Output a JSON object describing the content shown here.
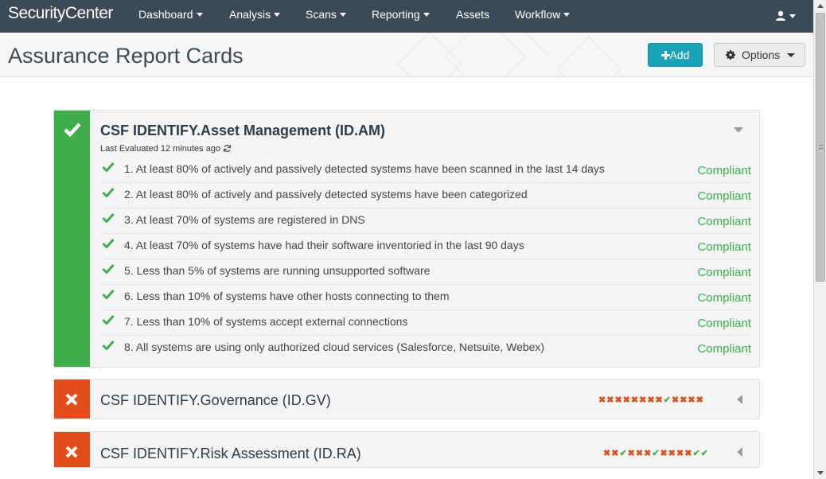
{
  "app": {
    "brand": "SecurityCenter"
  },
  "nav": {
    "items": [
      {
        "label": "Dashboard",
        "dropdown": true
      },
      {
        "label": "Analysis",
        "dropdown": true
      },
      {
        "label": "Scans",
        "dropdown": true
      },
      {
        "label": "Reporting",
        "dropdown": true
      },
      {
        "label": "Assets",
        "dropdown": false
      },
      {
        "label": "Workflow",
        "dropdown": true
      }
    ],
    "user_icon": "user-icon"
  },
  "header": {
    "title": "Assurance Report Cards",
    "add_label": "Add",
    "add_icon": "plus-icon",
    "options_label": "Options",
    "options_icon": "gear-icon"
  },
  "colors": {
    "nav_bg": "#3c4a57",
    "pass": "#3dae49",
    "fail": "#e24d1b",
    "accent": "#1aa3b8"
  },
  "cards": [
    {
      "title": "CSF IDENTIFY.Asset Management (ID.AM)",
      "status": "pass",
      "expanded": true,
      "last_evaluated": "Last Evaluated 12 minutes ago",
      "items": [
        {
          "text": "1. At least 80% of actively and passively detected systems have been scanned in the last 14 days",
          "status": "Compliant"
        },
        {
          "text": "2. At least 80% of actively and passively detected systems have been categorized",
          "status": "Compliant"
        },
        {
          "text": "3. At least 70% of systems are registered in DNS",
          "status": "Compliant"
        },
        {
          "text": "4. At least 70% of systems have had their software inventoried in the last 90 days",
          "status": "Compliant"
        },
        {
          "text": "5. Less than 5% of systems are running unsupported software",
          "status": "Compliant"
        },
        {
          "text": "6. Less than 10% of systems have other hosts connecting to them",
          "status": "Compliant"
        },
        {
          "text": "7. Less than 10% of systems accept external connections",
          "status": "Compliant"
        },
        {
          "text": "8. All systems are using only authorized cloud services (Salesforce, Netsuite, Webex)",
          "status": "Compliant"
        }
      ]
    },
    {
      "title": "CSF IDENTIFY.Governance (ID.GV)",
      "status": "fail",
      "expanded": false,
      "trend": [
        "x",
        "x",
        "x",
        "x",
        "x",
        "x",
        "x",
        "x",
        "c",
        "x",
        "x",
        "x",
        "x"
      ]
    },
    {
      "title": "CSF IDENTIFY.Risk Assessment (ID.RA)",
      "status": "fail",
      "expanded": false,
      "trend": [
        "x",
        "x",
        "c",
        "x",
        "x",
        "x",
        "c",
        "x",
        "x",
        "x",
        "x",
        "c",
        "c"
      ]
    }
  ]
}
